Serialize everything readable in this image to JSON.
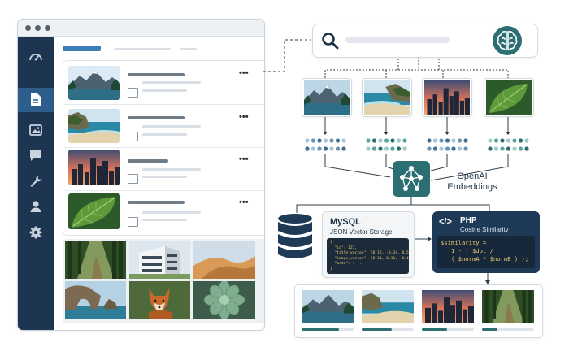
{
  "labels": {
    "embedding_service": "OpenAI Embeddings",
    "mysql_title": "MySQL",
    "mysql_subtitle": "JSON Vector Storage",
    "php_title": "PHP",
    "php_subtitle": "Cosine Similarity"
  },
  "mysql_json": [
    "{",
    "  \"id\": 123,",
    "  \"title_vector\": [0.12, -0.34, 0.56, ...],",
    "  \"image_vector\": [0.21, 0.11, -0.43, ...],",
    "  \"meta\": { ... }",
    "}"
  ],
  "php_code": [
    "$similarity =",
    "   1 - ( $dot /",
    "   ( $normA * $normB ) );"
  ],
  "icons": {
    "sidebar": [
      "dashboard-icon",
      "document-icon",
      "image-icon",
      "comment-icon",
      "wrench-icon",
      "user-icon",
      "gear-icon"
    ],
    "search": "search-icon",
    "brain": "brain-icon",
    "database": "database-icon",
    "code": "code-icon",
    "network": "neural-network-icon"
  },
  "colors": {
    "sidebar": "#1d3550",
    "sidebar_active": "#2d5d8a",
    "accent_teal": "#2b6f72",
    "dark_panel": "#1f3a57",
    "code_yellow": "#e8c66a"
  },
  "media_thumbnails": [
    "mountain lake",
    "beach cove",
    "city skyline at sunset",
    "green leaf"
  ],
  "gallery": [
    "forest path",
    "modern building",
    "sand dunes",
    "sea arch",
    "red fox",
    "succulent"
  ],
  "results": [
    "mountain lake",
    "beach cove",
    "city skyline",
    "forest path"
  ],
  "result_scores": [
    0.72,
    0.58,
    0.48,
    0.3
  ]
}
